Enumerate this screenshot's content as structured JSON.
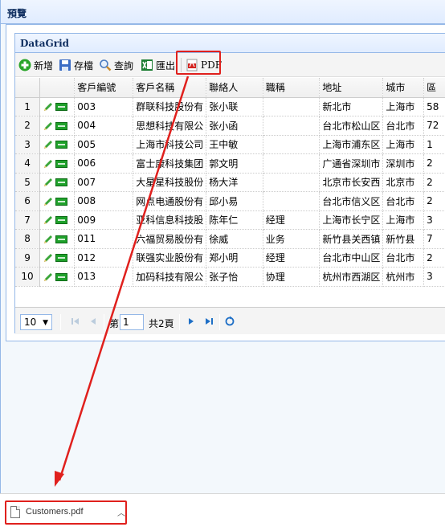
{
  "window": {
    "title": "預覽"
  },
  "panel": {
    "title": "DataGrid"
  },
  "toolbar": {
    "items": [
      {
        "label": "新增",
        "icon": "add-icon"
      },
      {
        "label": "存檔",
        "icon": "save-icon"
      },
      {
        "label": "查詢",
        "icon": "search-icon"
      },
      {
        "label": "匯出",
        "icon": "excel-icon"
      },
      {
        "label": "PDF",
        "icon": "pdf-icon"
      }
    ]
  },
  "grid": {
    "columns": [
      "客戶編號",
      "客戶名稱",
      "聯絡人",
      "職稱",
      "地址",
      "城市",
      "區"
    ],
    "rows": [
      {
        "n": "1",
        "id": "003",
        "name": "群联科技股份有",
        "contact": "张小联",
        "title": "",
        "address": "新北市",
        "city": "上海市",
        "extra": "58"
      },
      {
        "n": "2",
        "id": "004",
        "name": "思想科技有限公",
        "contact": "张小函",
        "title": "",
        "address": "台北市松山区",
        "city": "台北市",
        "extra": "72"
      },
      {
        "n": "3",
        "id": "005",
        "name": "上海市科技公司",
        "contact": "王中敏",
        "title": "",
        "address": "上海市浦东区",
        "city": "上海市",
        "extra": "1"
      },
      {
        "n": "4",
        "id": "006",
        "name": "富士康科技集团",
        "contact": "郭文明",
        "title": "",
        "address": "广通省深圳市",
        "city": "深圳市",
        "extra": "2"
      },
      {
        "n": "5",
        "id": "007",
        "name": "大星星科技股份",
        "contact": "杨大洋",
        "title": "",
        "address": "北京市长安西",
        "city": "北京市",
        "extra": "2"
      },
      {
        "n": "6",
        "id": "008",
        "name": "网点电通股份有",
        "contact": "邱小易",
        "title": "",
        "address": "台北市信义区",
        "city": "台北市",
        "extra": "2"
      },
      {
        "n": "7",
        "id": "009",
        "name": "亚科信息科技股",
        "contact": "陈年仁",
        "title": "经理",
        "address": "上海市长宁区",
        "city": "上海市",
        "extra": "3"
      },
      {
        "n": "8",
        "id": "011",
        "name": "六福贸易股份有",
        "contact": "徐威",
        "title": "业务",
        "address": "新竹县关西镇",
        "city": "新竹县",
        "extra": "7"
      },
      {
        "n": "9",
        "id": "012",
        "name": "联强实业股份有",
        "contact": "郑小明",
        "title": "经理",
        "address": "台北市中山区",
        "city": "台北市",
        "extra": "2"
      },
      {
        "n": "10",
        "id": "013",
        "name": "加码科技有限公",
        "contact": "张子怡",
        "title": "协理",
        "address": "杭州市西湖区",
        "city": "杭州市",
        "extra": "3"
      }
    ]
  },
  "pager": {
    "page_size": "10",
    "page_label": "第",
    "page_value": "1",
    "total_label": "共2頁"
  },
  "download": {
    "filename": "Customers.pdf"
  },
  "colors": {
    "highlight": "#e0201d",
    "border": "#95b8e7",
    "header": "#0e2d5f"
  }
}
